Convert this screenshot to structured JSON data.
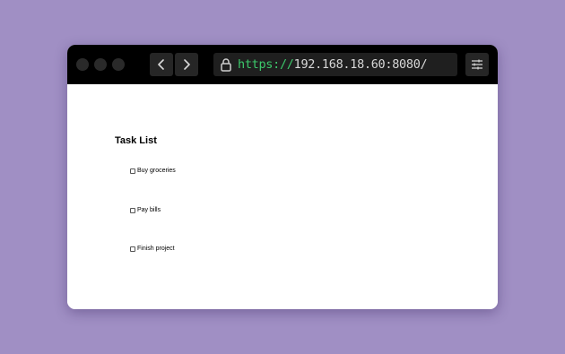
{
  "browser": {
    "url_scheme": "https://",
    "url_host": "192.168.18.60:8080/",
    "icons": {
      "back": "chevron-left-icon",
      "forward": "chevron-right-icon",
      "lock": "lock-icon",
      "settings": "sliders-icon"
    }
  },
  "page": {
    "title": "Task List",
    "tasks": [
      {
        "label": "Buy groceries",
        "checked": false
      },
      {
        "label": "Pay bills",
        "checked": false
      },
      {
        "label": "Finish project",
        "checked": false
      }
    ]
  },
  "colors": {
    "background": "#a08fc4",
    "toolbar": "#000000",
    "url_scheme": "#3cc96b",
    "url_host": "#d8d8d8"
  }
}
